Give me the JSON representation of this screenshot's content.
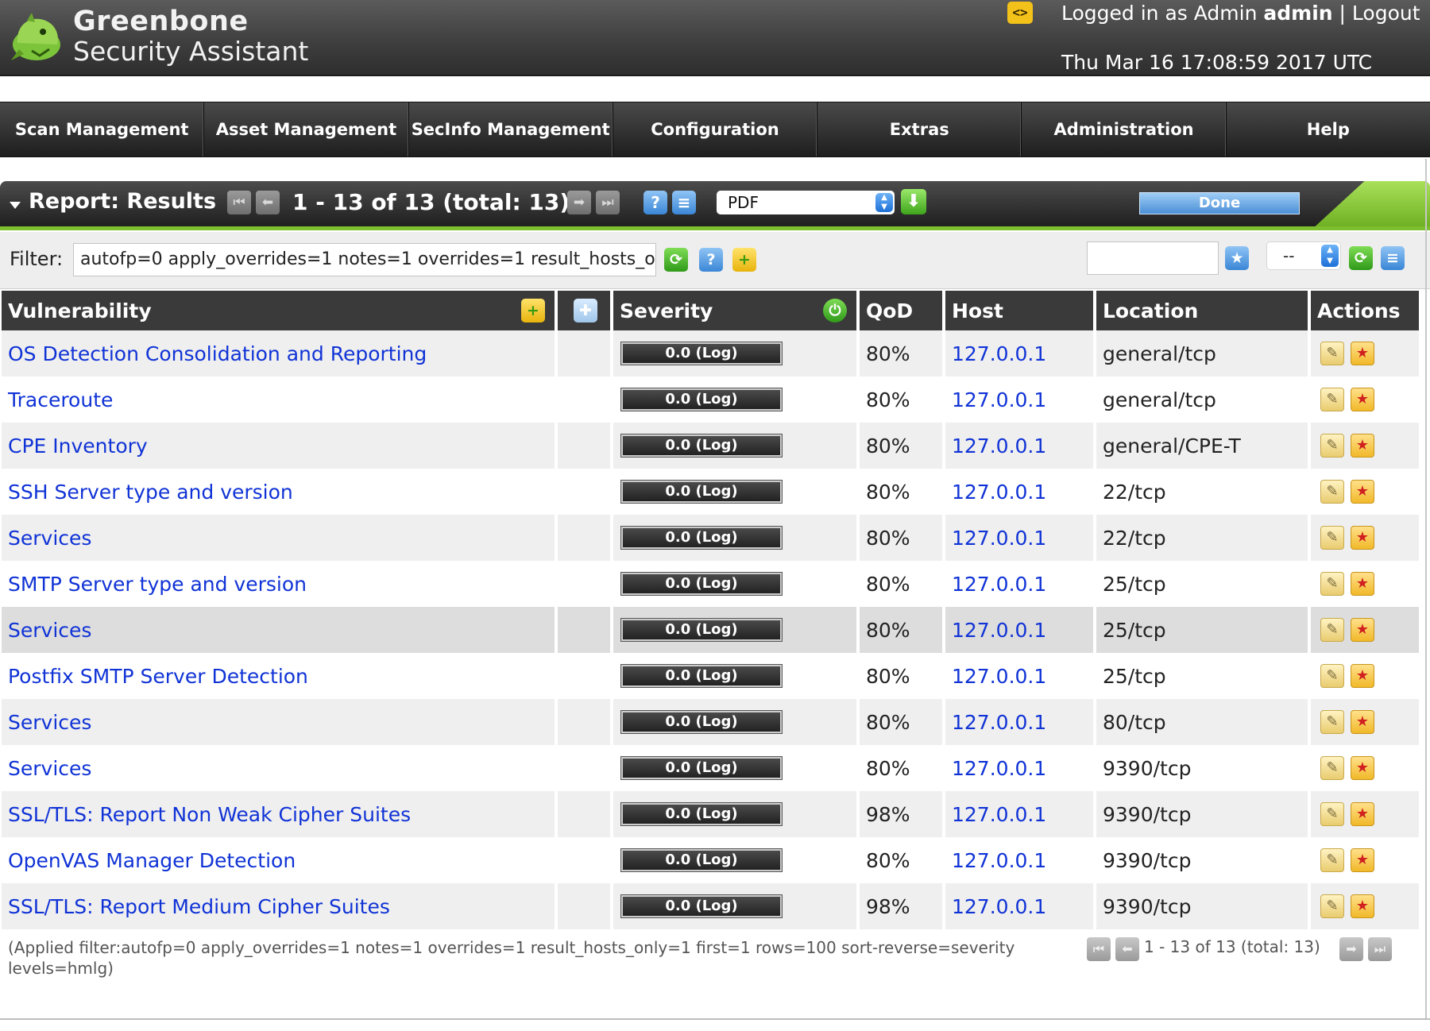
{
  "header": {
    "brand_line1": "Greenbone",
    "brand_line2": "Security Assistant",
    "code_icon": "<>",
    "logged_in_prefix": "Logged in as Admin",
    "username": "admin",
    "separator": "|",
    "logout": "Logout",
    "datetime": "Thu Mar 16 17:08:59 2017 UTC"
  },
  "nav": [
    {
      "label": "Scan Management"
    },
    {
      "label": "Asset Management"
    },
    {
      "label": "SecInfo Management"
    },
    {
      "label": "Configuration"
    },
    {
      "label": "Extras"
    },
    {
      "label": "Administration"
    },
    {
      "label": "Help"
    }
  ],
  "report": {
    "title": "Report: Results",
    "count": "1 - 13 of 13 (total: 13)",
    "format_selected": "PDF",
    "done_label": "Done"
  },
  "filter": {
    "label": "Filter:",
    "value": "autofp=0 apply_overrides=1 notes=1 overrides=1 result_hosts_only=1 first=1 rows=100 sort-reverse=severity levels=hmlg",
    "filter_name_value": "",
    "saved_filter_selected": "--"
  },
  "table": {
    "headers": {
      "vulnerability": "Vulnerability",
      "severity": "Severity",
      "qod": "QoD",
      "host": "Host",
      "location": "Location",
      "actions": "Actions"
    },
    "rows": [
      {
        "vulnerability": "OS Detection Consolidation and Reporting",
        "severity": "0.0 (Log)",
        "qod": "80%",
        "host": "127.0.0.1",
        "location": "general/tcp"
      },
      {
        "vulnerability": "Traceroute",
        "severity": "0.0 (Log)",
        "qod": "80%",
        "host": "127.0.0.1",
        "location": "general/tcp"
      },
      {
        "vulnerability": "CPE Inventory",
        "severity": "0.0 (Log)",
        "qod": "80%",
        "host": "127.0.0.1",
        "location": "general/CPE-T"
      },
      {
        "vulnerability": "SSH Server type and version",
        "severity": "0.0 (Log)",
        "qod": "80%",
        "host": "127.0.0.1",
        "location": "22/tcp"
      },
      {
        "vulnerability": "Services",
        "severity": "0.0 (Log)",
        "qod": "80%",
        "host": "127.0.0.1",
        "location": "22/tcp"
      },
      {
        "vulnerability": "SMTP Server type and version",
        "severity": "0.0 (Log)",
        "qod": "80%",
        "host": "127.0.0.1",
        "location": "25/tcp"
      },
      {
        "vulnerability": "Services",
        "severity": "0.0 (Log)",
        "qod": "80%",
        "host": "127.0.0.1",
        "location": "25/tcp"
      },
      {
        "vulnerability": "Postfix SMTP Server Detection",
        "severity": "0.0 (Log)",
        "qod": "80%",
        "host": "127.0.0.1",
        "location": "25/tcp"
      },
      {
        "vulnerability": "Services",
        "severity": "0.0 (Log)",
        "qod": "80%",
        "host": "127.0.0.1",
        "location": "80/tcp"
      },
      {
        "vulnerability": "Services",
        "severity": "0.0 (Log)",
        "qod": "80%",
        "host": "127.0.0.1",
        "location": "9390/tcp"
      },
      {
        "vulnerability": "SSL/TLS: Report Non Weak Cipher Suites",
        "severity": "0.0 (Log)",
        "qod": "98%",
        "host": "127.0.0.1",
        "location": "9390/tcp"
      },
      {
        "vulnerability": "OpenVAS Manager Detection",
        "severity": "0.0 (Log)",
        "qod": "80%",
        "host": "127.0.0.1",
        "location": "9390/tcp"
      },
      {
        "vulnerability": "SSL/TLS: Report Medium Cipher Suites",
        "severity": "0.0 (Log)",
        "qod": "98%",
        "host": "127.0.0.1",
        "location": "9390/tcp"
      }
    ]
  },
  "footer": {
    "applied_filter": "(Applied filter:autofp=0 apply_overrides=1 notes=1 overrides=1 result_hosts_only=1 first=1 rows=100 sort-reverse=severity levels=hmlg)",
    "count": "1 - 13 of 13 (total: 13)"
  },
  "colors": {
    "link": "#1033d6",
    "accent_green": "#7dbf2f",
    "header_dark": "#3d3d3d"
  },
  "icons": [
    "greenbone-logo-icon",
    "code-icon",
    "first-page-icon",
    "previous-page-icon",
    "next-page-icon",
    "last-page-icon",
    "help-icon",
    "list-icon",
    "download-icon",
    "refresh-icon",
    "new-filter-icon",
    "star-icon",
    "new-note-icon",
    "plugin-icon",
    "auto-refresh-icon",
    "add-note-icon",
    "add-override-icon"
  ]
}
